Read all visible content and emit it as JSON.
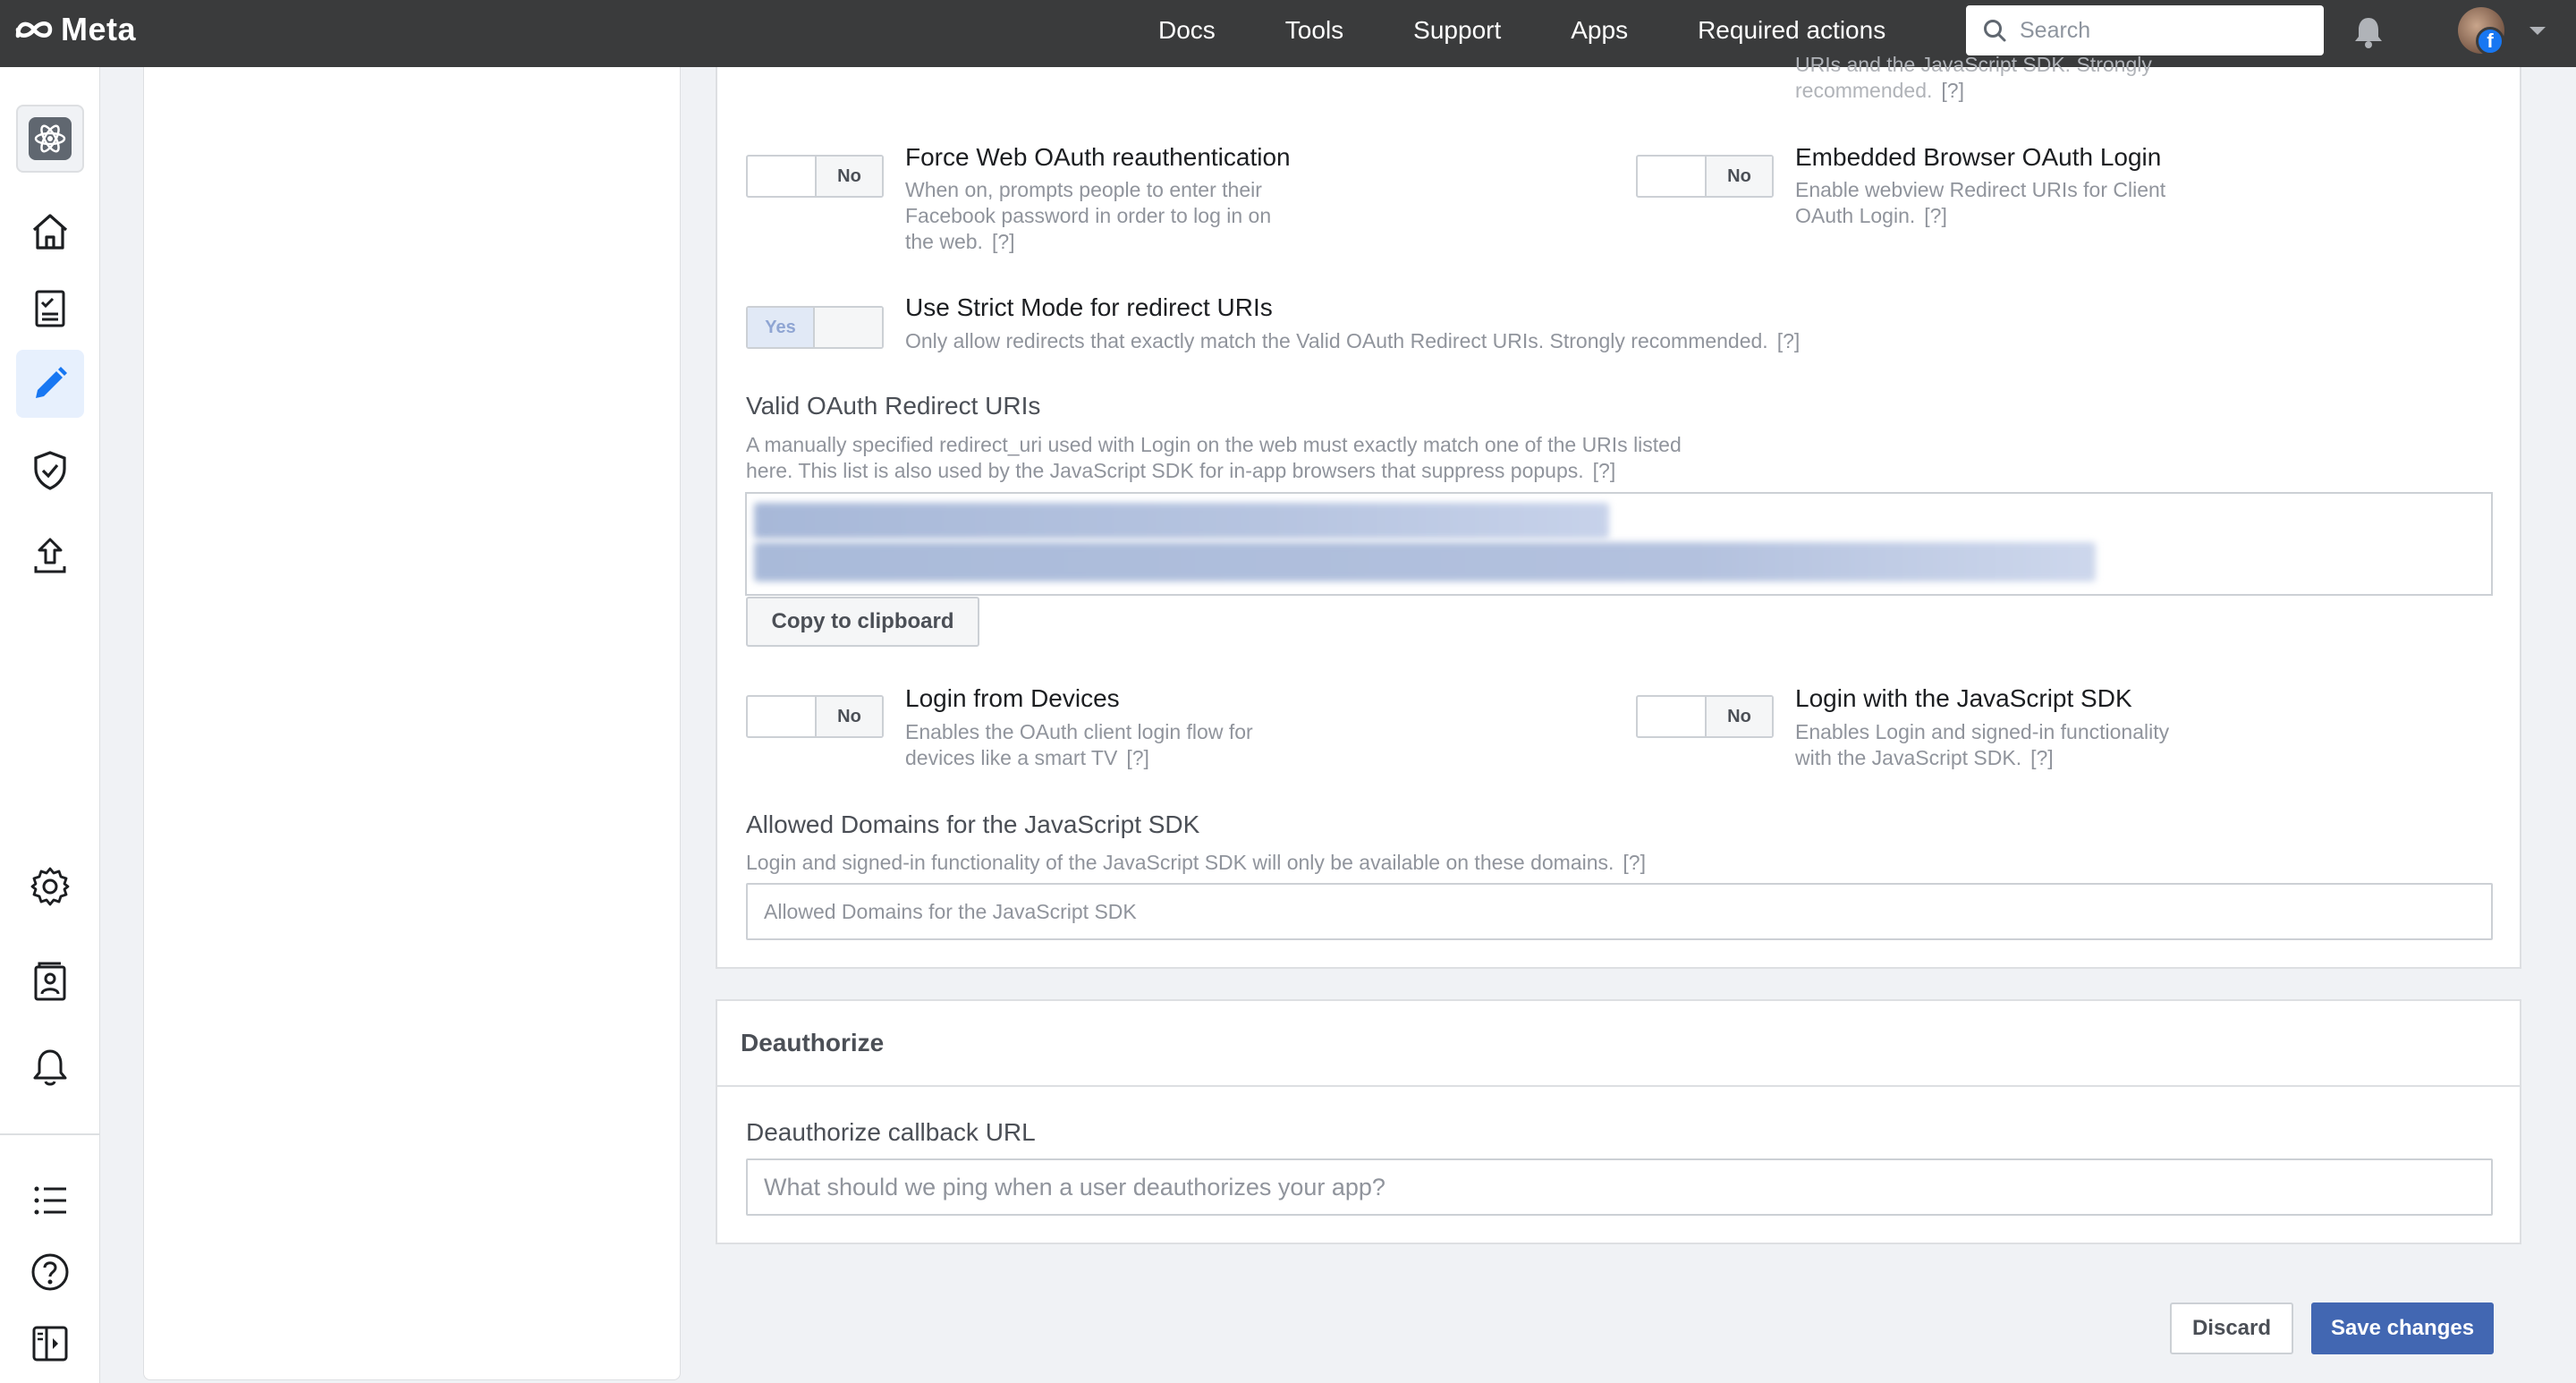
{
  "topbar": {
    "logo_text": "Meta",
    "nav": [
      "Docs",
      "Tools",
      "Support",
      "Apps",
      "Required actions"
    ],
    "search_placeholder": "Search",
    "fb_badge": "f"
  },
  "partial_top": {
    "right_desc_line1": "URIs and the JavaScript SDK. Strongly",
    "right_desc_line2": "recommended.",
    "help": "[?]"
  },
  "settings": {
    "force_reauth": {
      "toggle": "No",
      "title": "Force Web OAuth reauthentication",
      "desc_lines": [
        "When on, prompts people to enter their",
        "Facebook password in order to log in on",
        "the web."
      ],
      "help": "[?]"
    },
    "embedded_browser": {
      "toggle": "No",
      "title": "Embedded Browser OAuth Login",
      "desc_lines": [
        "Enable webview Redirect URIs for Client",
        "OAuth Login."
      ],
      "help": "[?]"
    },
    "strict_mode": {
      "toggle": "Yes",
      "title": "Use Strict Mode for redirect URIs",
      "desc": "Only allow redirects that exactly match the Valid OAuth Redirect URIs. Strongly recommended.",
      "help": "[?]"
    },
    "redirect_uris": {
      "label": "Valid OAuth Redirect URIs",
      "desc_lines": [
        "A manually specified redirect_uri used with Login on the web must exactly match one of the URIs listed",
        "here. This list is also used by the JavaScript SDK for in-app browsers that suppress popups."
      ],
      "help": "[?]",
      "copy_button": "Copy to clipboard"
    },
    "login_devices": {
      "toggle": "No",
      "title": "Login from Devices",
      "desc_lines": [
        "Enables the OAuth client login flow for",
        "devices like a smart TV"
      ],
      "help": "[?]"
    },
    "login_js_sdk": {
      "toggle": "No",
      "title": "Login with the JavaScript SDK",
      "desc_lines": [
        "Enables Login and signed-in functionality",
        "with the JavaScript SDK."
      ],
      "help": "[?]"
    },
    "allowed_domains": {
      "label": "Allowed Domains for the JavaScript SDK",
      "desc": "Login and signed-in functionality of the JavaScript SDK will only be available on these domains.",
      "help": "[?]",
      "placeholder": "Allowed Domains for the JavaScript SDK"
    }
  },
  "deauthorize": {
    "header": "Deauthorize",
    "label": "Deauthorize callback URL",
    "placeholder": "What should we ping when a user deauthorizes your app?"
  },
  "footer": {
    "discard": "Discard",
    "save": "Save changes"
  }
}
